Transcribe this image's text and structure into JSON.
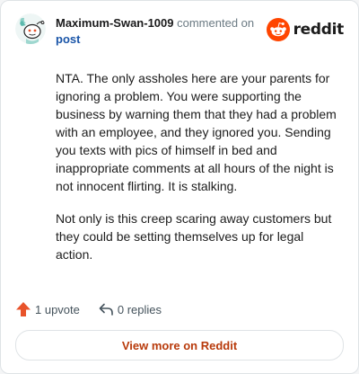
{
  "header": {
    "username": "Maximum-Swan-1009",
    "action_text": "commented on",
    "link_text": "post",
    "brand_name": "reddit"
  },
  "comment": {
    "paragraphs": [
      "NTA. The only assholes here are your parents for ignoring a problem. You were supporting the business by warning them that they had a problem with an employee, and they ignored you. Sending you texts with pics of himself in bed and inappropriate comments at all hours of the night is not innocent flirting. It is stalking.",
      "Not only is this creep scaring away customers but they could be setting themselves up for legal action."
    ]
  },
  "actions": {
    "upvote_label": "1 upvote",
    "reply_label": "0 replies"
  },
  "footer": {
    "view_more_label": "View more on Reddit"
  },
  "colors": {
    "accent": "#ff4500",
    "link": "#1a55a8",
    "view_more": "#b83a0b"
  },
  "icons": {
    "avatar": "snoo-avatar-icon",
    "brand": "reddit-logo-icon",
    "upvote": "upvote-arrow-icon",
    "reply": "reply-arrow-icon"
  }
}
